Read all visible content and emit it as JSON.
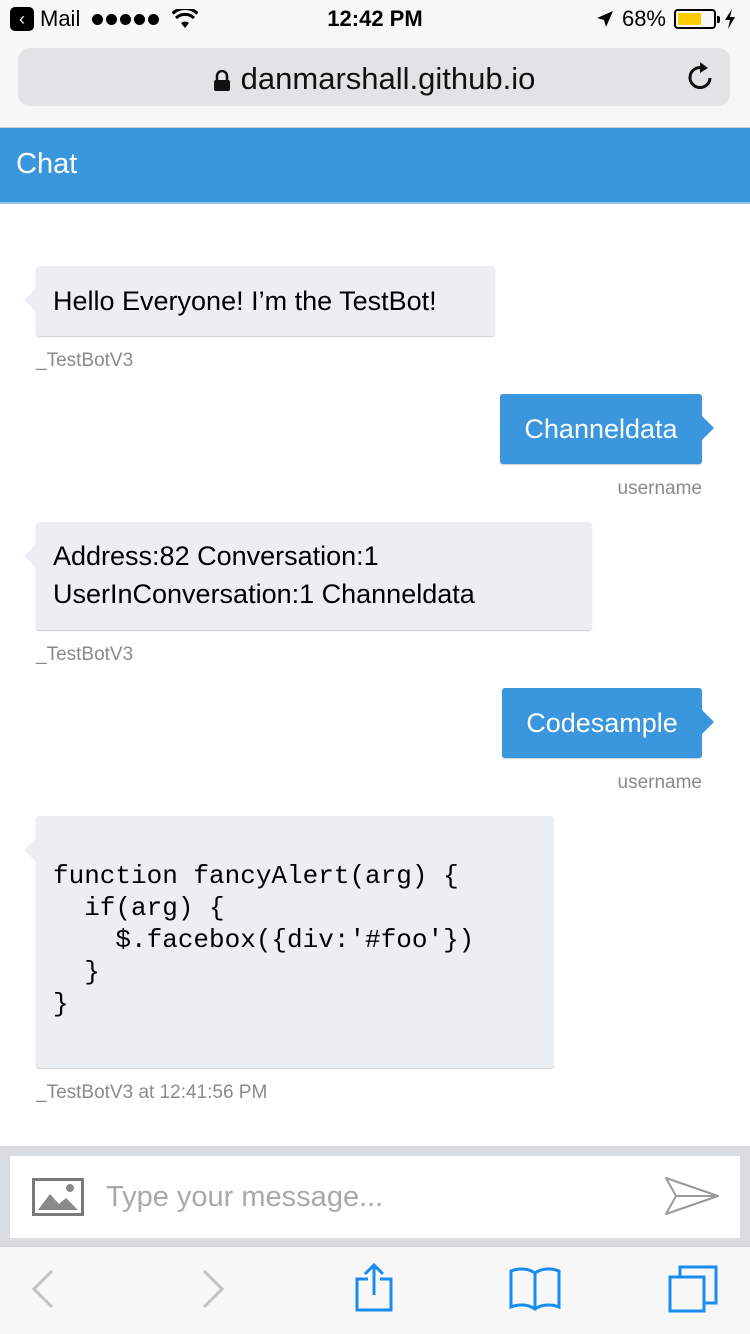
{
  "status_bar": {
    "back_app": "Mail",
    "time": "12:42 PM",
    "battery_percent": "68%",
    "battery_level": 0.68,
    "battery_color": "#ffcc00"
  },
  "browser": {
    "url": "danmarshall.github.io"
  },
  "chat": {
    "title": "Chat",
    "accent_color": "#3a96dd",
    "messages": [
      {
        "from": "bot",
        "text": "Hello Everyone! I’m the TestBot!",
        "meta": "_TestBotV3"
      },
      {
        "from": "user",
        "text": "Channeldata",
        "meta": "username"
      },
      {
        "from": "bot",
        "text_line1": "Address:82 Conversation:1",
        "text_line2": "UserInConversation:1 Channeldata",
        "meta": "_TestBotV3"
      },
      {
        "from": "user",
        "text": "Codesample",
        "meta": "username"
      },
      {
        "from": "bot",
        "code": "function fancyAlert(arg) {\n  if(arg) {\n    $.facebox({div:'#foo'})\n  }\n}",
        "meta": "_TestBotV3 at 12:41:56 PM"
      }
    ]
  },
  "compose": {
    "placeholder": "Type your message...",
    "value": ""
  },
  "icons": {
    "image_upload": "image-icon",
    "send": "send-icon",
    "back": "chevron-left-icon",
    "forward": "chevron-right-icon",
    "share": "share-icon",
    "bookmarks": "book-icon",
    "tabs": "tabs-icon"
  }
}
